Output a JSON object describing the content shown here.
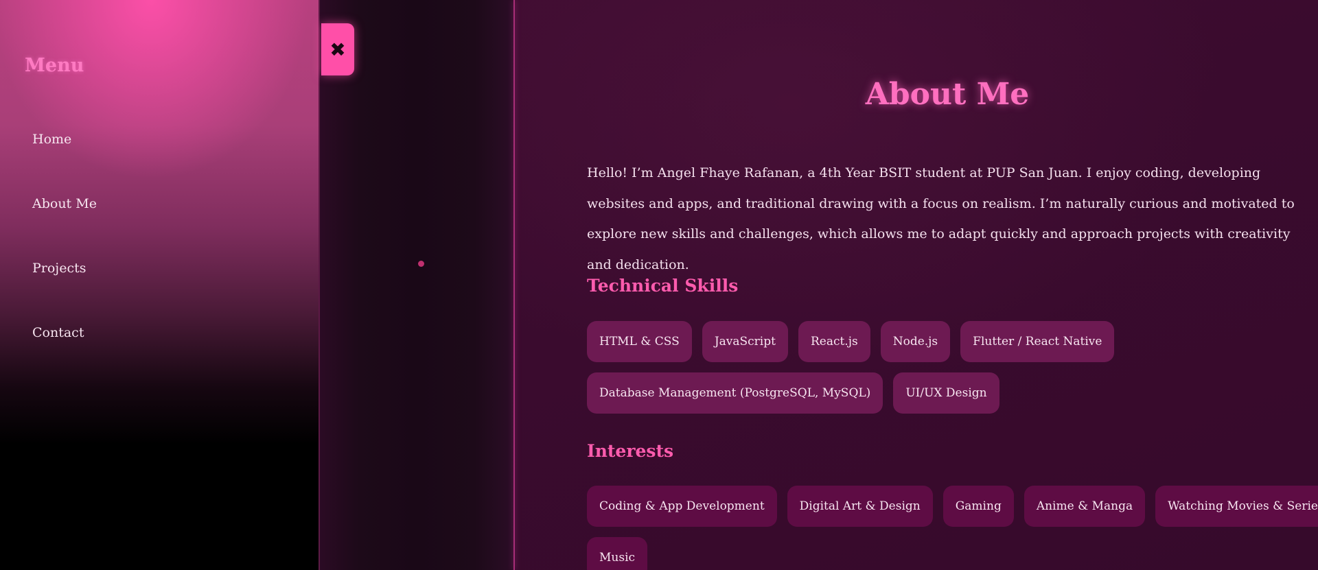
{
  "sidebar": {
    "title": "Menu",
    "items": [
      {
        "label": "Home"
      },
      {
        "label": "About Me"
      },
      {
        "label": "Projects"
      },
      {
        "label": "Contact"
      }
    ]
  },
  "close_button": {
    "icon": "close-icon",
    "glyph": "✖"
  },
  "about": {
    "title": "About Me",
    "bio": "Hello! I’m Angel Fhaye Rafanan, a 4th Year BSIT student at PUP San Juan. I enjoy coding, developing websites and apps, and traditional drawing with a focus on realism. I’m naturally curious and motivated to explore new skills and challenges, which allows me to adapt quickly and approach projects with creativity and dedication.",
    "skills_heading": "Technical Skills",
    "skills": [
      "HTML & CSS",
      "JavaScript",
      "React.js",
      "Node.js",
      "Flutter / React Native",
      "Database Management (PostgreSQL, MySQL)",
      "UI/UX Design"
    ],
    "interests_heading": "Interests",
    "interests": [
      "Coding & App Development",
      "Digital Art & Design",
      "Gaming",
      "Anime & Manga",
      "Watching Movies & Series",
      "Music"
    ]
  },
  "colors": {
    "accent": "#ff4fa8",
    "heading": "#ff6fbf",
    "content_bg": "#3a0b2e"
  }
}
